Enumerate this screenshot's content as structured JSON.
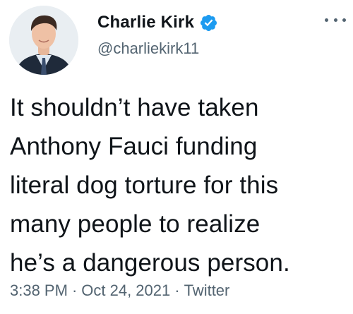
{
  "tweet": {
    "author": {
      "display_name": "Charlie Kirk",
      "handle": "@charliekirk11",
      "verified": true,
      "avatar_icon": "profile-photo"
    },
    "more_icon": "more-options-icon",
    "text": "It shouldn’t have taken\nAnthony Fauci funding\nliteral dog torture for this\nmany people to realize\nhe’s a dangerous person.",
    "time": "3:38 PM",
    "date": "Oct 24, 2021",
    "source": "Twitter",
    "separator": "·"
  },
  "colors": {
    "text_primary": "#0f1419",
    "text_secondary": "#536471",
    "verified_blue": "#1d9bf0",
    "background": "#ffffff"
  }
}
